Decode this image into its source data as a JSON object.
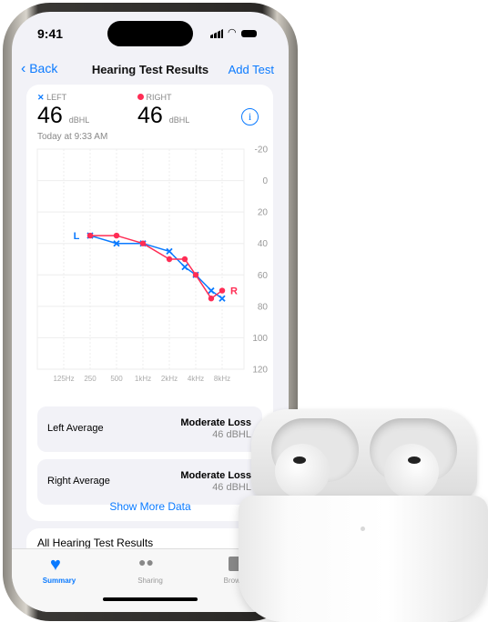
{
  "status_bar": {
    "time": "9:41"
  },
  "nav": {
    "back_label": "Back",
    "title": "Hearing Test Results",
    "action_label": "Add Test"
  },
  "summary": {
    "left_label": "LEFT",
    "right_label": "RIGHT",
    "left_value": "46",
    "right_value": "46",
    "unit": "dBHL",
    "timestamp": "Today at 9:33 AM"
  },
  "averages": [
    {
      "label": "Left Average",
      "classification": "Moderate Loss",
      "value": "46 dBHL"
    },
    {
      "label": "Right Average",
      "classification": "Moderate Loss",
      "value": "46 dBHL"
    }
  ],
  "show_more_label": "Show More Data",
  "all_results_title": "All Hearing Test Results",
  "tabs": [
    {
      "label": "Summary",
      "icon": "heart-icon",
      "active": true
    },
    {
      "label": "Sharing",
      "icon": "people-icon"
    },
    {
      "label": "Browse",
      "icon": "grid-icon"
    }
  ],
  "colors": {
    "accent": "#0a7aff",
    "left": "#0a7aff",
    "right": "#ff2d55"
  },
  "chart_data": {
    "type": "line",
    "x_ticks": [
      "125Hz",
      "250",
      "500",
      "1kHz",
      "2kHz",
      "4kHz",
      "8kHz"
    ],
    "y_ticks": [
      "-20",
      "0",
      "20",
      "40",
      "60",
      "80",
      "100",
      "120"
    ],
    "ylim": [
      -20,
      120
    ],
    "y_inverted": true,
    "x_scale": "log",
    "grid": true,
    "series": [
      {
        "name": "L",
        "marker": "x",
        "color": "#0a7aff",
        "points": [
          [
            250,
            35
          ],
          [
            500,
            40
          ],
          [
            1000,
            40
          ],
          [
            2000,
            45
          ],
          [
            3000,
            55
          ],
          [
            4000,
            60
          ],
          [
            6000,
            70
          ],
          [
            8000,
            75
          ]
        ]
      },
      {
        "name": "R",
        "marker": "circle",
        "color": "#ff2d55",
        "points": [
          [
            250,
            35
          ],
          [
            500,
            35
          ],
          [
            1000,
            40
          ],
          [
            2000,
            50
          ],
          [
            3000,
            50
          ],
          [
            4000,
            60
          ],
          [
            6000,
            75
          ],
          [
            8000,
            70
          ]
        ]
      }
    ]
  }
}
